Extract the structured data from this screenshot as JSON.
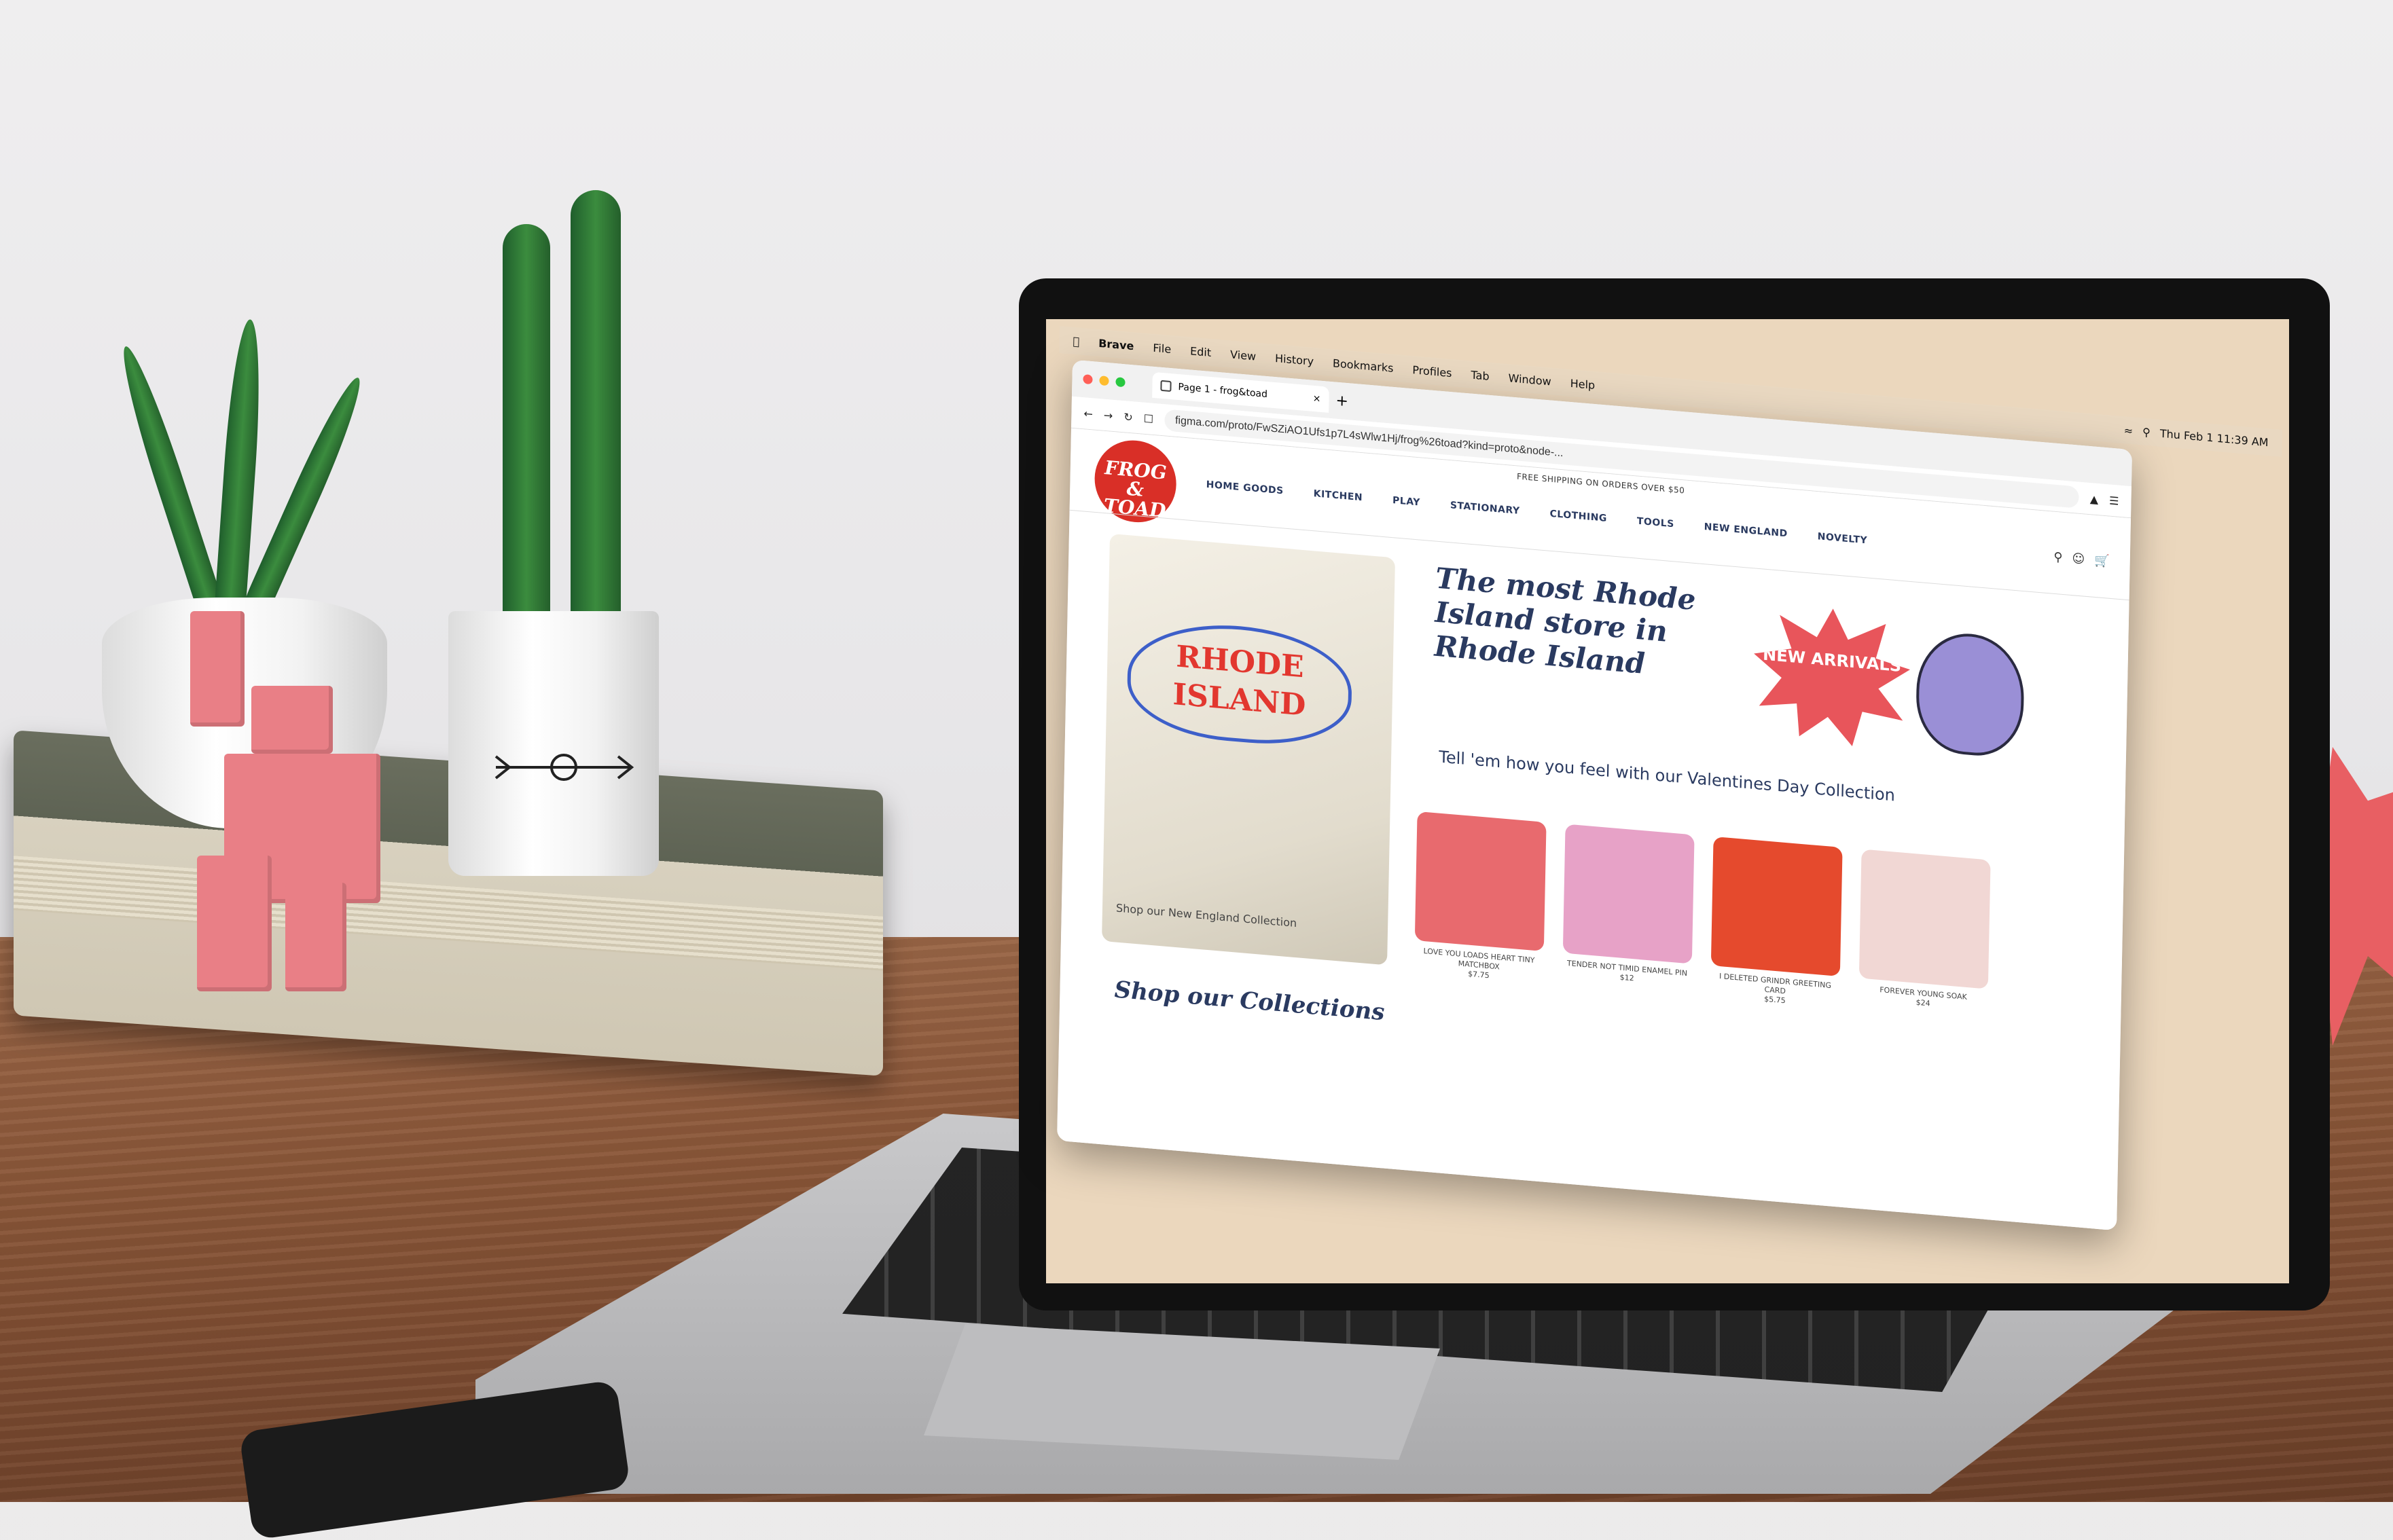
{
  "menubar": {
    "app": "Brave",
    "items": [
      "File",
      "Edit",
      "View",
      "History",
      "Bookmarks",
      "Profiles",
      "Tab",
      "Window",
      "Help"
    ],
    "clock": "Thu Feb 1  11:39 AM"
  },
  "browser": {
    "tab_title": "Page 1 - frog&toad",
    "url": "figma.com/proto/FwSZiAO1Ufs1p7L4sWlw1Hj/frog%26toad?kind=proto&node-..."
  },
  "site": {
    "announcement": "FREE SHIPPING ON ORDERS OVER $50",
    "logo_text": "FROG & TOAD",
    "nav": [
      "HOME GOODS",
      "KITCHEN",
      "PLAY",
      "STATIONARY",
      "CLOTHING",
      "TOOLS",
      "NEW ENGLAND",
      "NOVELTY"
    ],
    "hero": {
      "image_text": "RHODE ISLAND",
      "caption": "Shop our New England Collection"
    },
    "headline": "The most Rhode Island store in Rhode Island",
    "badge": "NEW ARRIVALS",
    "subhead": "Tell 'em how you feel with our Valentines Day Collection",
    "products": [
      {
        "name": "LOVE YOU LOADS HEART TINY MATCHBOX",
        "price": "$7.75",
        "color": "#e86a6e"
      },
      {
        "name": "TENDER NOT TIMID ENAMEL PIN",
        "price": "$12",
        "color": "#e7a2c7"
      },
      {
        "name": "I DELETED GRINDR GREETING CARD",
        "price": "$5.75",
        "color": "#e54a2d"
      },
      {
        "name": "FOREVER YOUNG SOAK",
        "price": "$24",
        "color": "#f1d7d4"
      }
    ],
    "collections_title": "Shop our Collections"
  }
}
